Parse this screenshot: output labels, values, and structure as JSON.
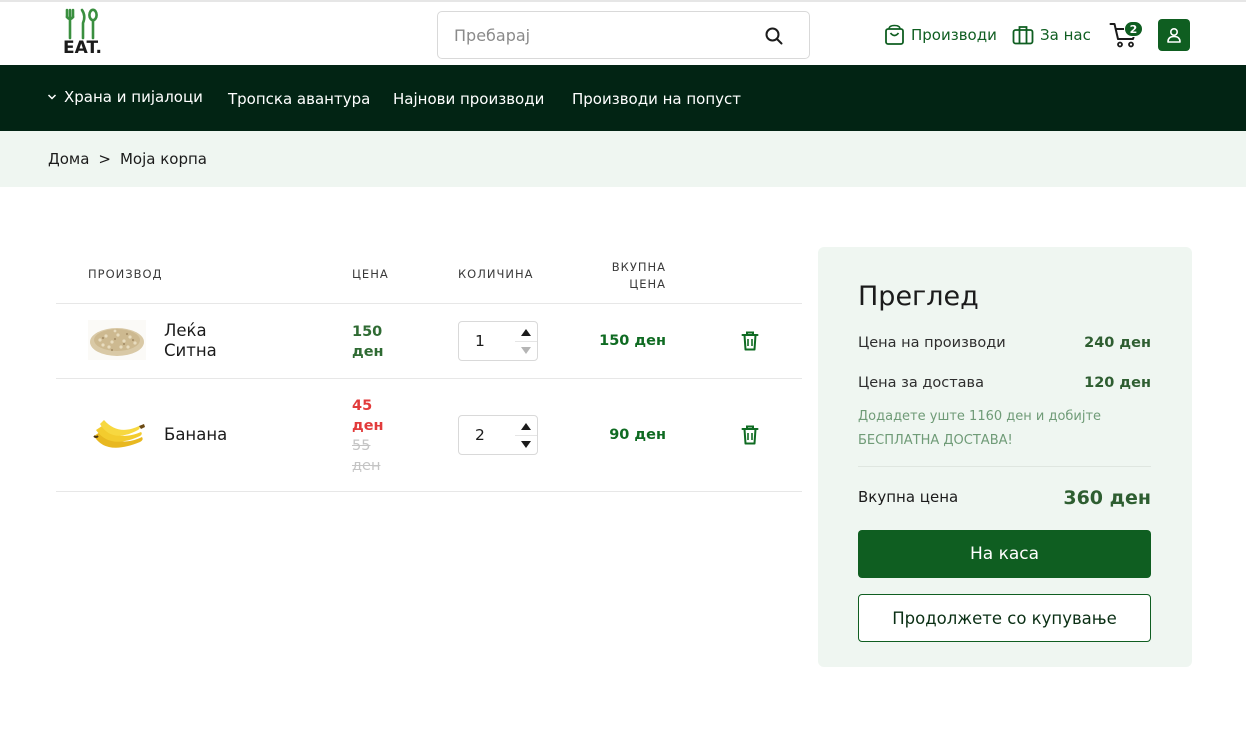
{
  "header": {
    "logo_text": "EAT.",
    "search_placeholder": "Пребарај",
    "nav_products": "Производи",
    "nav_about": "За нас",
    "cart_count": "2"
  },
  "menu": {
    "items": [
      {
        "label": "Храна и пијалоци"
      },
      {
        "label": "Тропска авантура"
      },
      {
        "label": "Најнови производи"
      },
      {
        "label": "Производи на попуст"
      }
    ]
  },
  "breadcrumb": {
    "home": "Дома",
    "separator": ">",
    "current": "Моја корпа"
  },
  "cart_table": {
    "col_product": "ПРОИЗВОД",
    "col_price": "ЦЕНА",
    "col_qty": "КОЛИЧИНА",
    "col_total_1": "ВКУПНА",
    "col_total_2": "ЦЕНА",
    "rows": [
      {
        "name_1": "Леќа",
        "name_2": "Ситна",
        "price_amount": "150",
        "price_unit": "ден",
        "quantity": "1",
        "line_total": "150 ден"
      },
      {
        "name": "Банана",
        "sale_amount": "45",
        "sale_unit": "ден",
        "old_amount": "55",
        "old_unit": "ден",
        "quantity": "2",
        "line_total": "90 ден"
      }
    ]
  },
  "summary": {
    "title": "Преглед",
    "products_label": "Цена на производи",
    "products_value": "240 ден",
    "delivery_label": "Цена за достава",
    "delivery_value": "120 ден",
    "free_delivery_note": "Додадете уште 1160 ден и добијте БЕСПЛАТНА ДОСТАВА!",
    "total_label": "Вкупна цена",
    "total_value": "360 ден",
    "checkout_label": "На каса",
    "continue_label": "Продолжете со купување"
  },
  "colors": {
    "brand_green": "#0f5e21",
    "menu_bg": "#022414",
    "sale_red": "#e23b3b",
    "panel_bg": "#eff6f1"
  }
}
